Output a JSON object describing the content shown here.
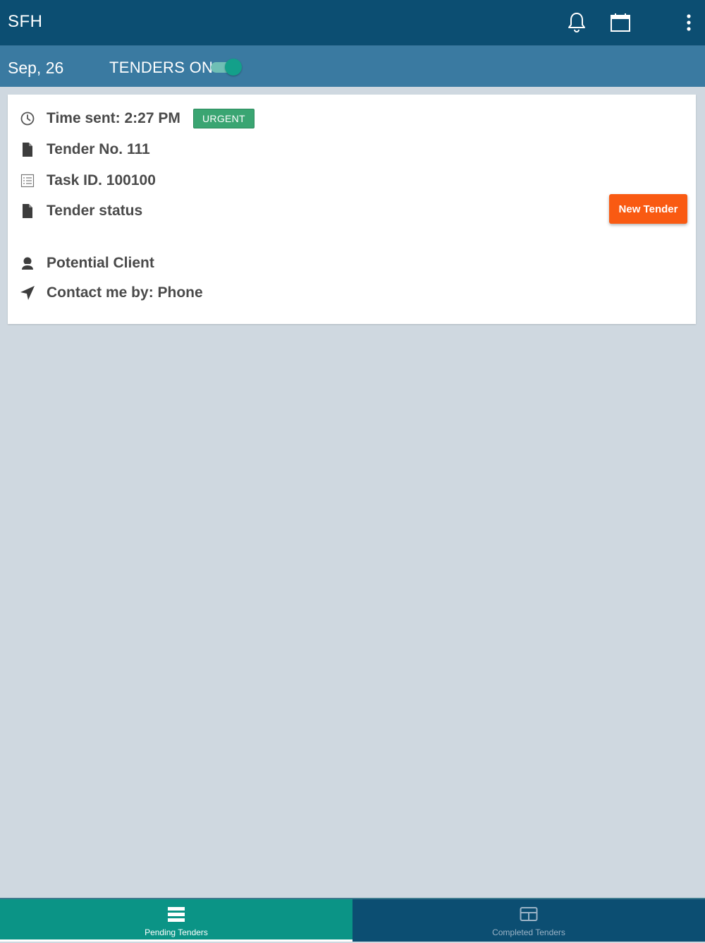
{
  "appbar": {
    "title": "SFH",
    "icons": [
      "bell-icon",
      "calendar-icon",
      "more-vert-icon"
    ]
  },
  "subbar": {
    "date": "Sep, 26",
    "tenders_label": "TENDERS ON",
    "tenders_on": true
  },
  "tender": {
    "time_sent": "Time sent: 2:27 PM",
    "badge": "URGENT",
    "tender_no": "Tender No. 111",
    "task_id": "Task ID. 100100",
    "status_label": "Tender status",
    "status_button": "New Tender",
    "client": "Potential Client",
    "contact": "Contact me by: Phone"
  },
  "bottom_nav": {
    "pending": "Pending Tenders",
    "completed": "Completed Tenders",
    "active": "pending"
  },
  "colors": {
    "appbar": "#0c4e72",
    "subbar": "#3a7aa1",
    "badge": "#3aa572",
    "accent_button": "#f95a12",
    "active_tab": "#0b9486"
  }
}
